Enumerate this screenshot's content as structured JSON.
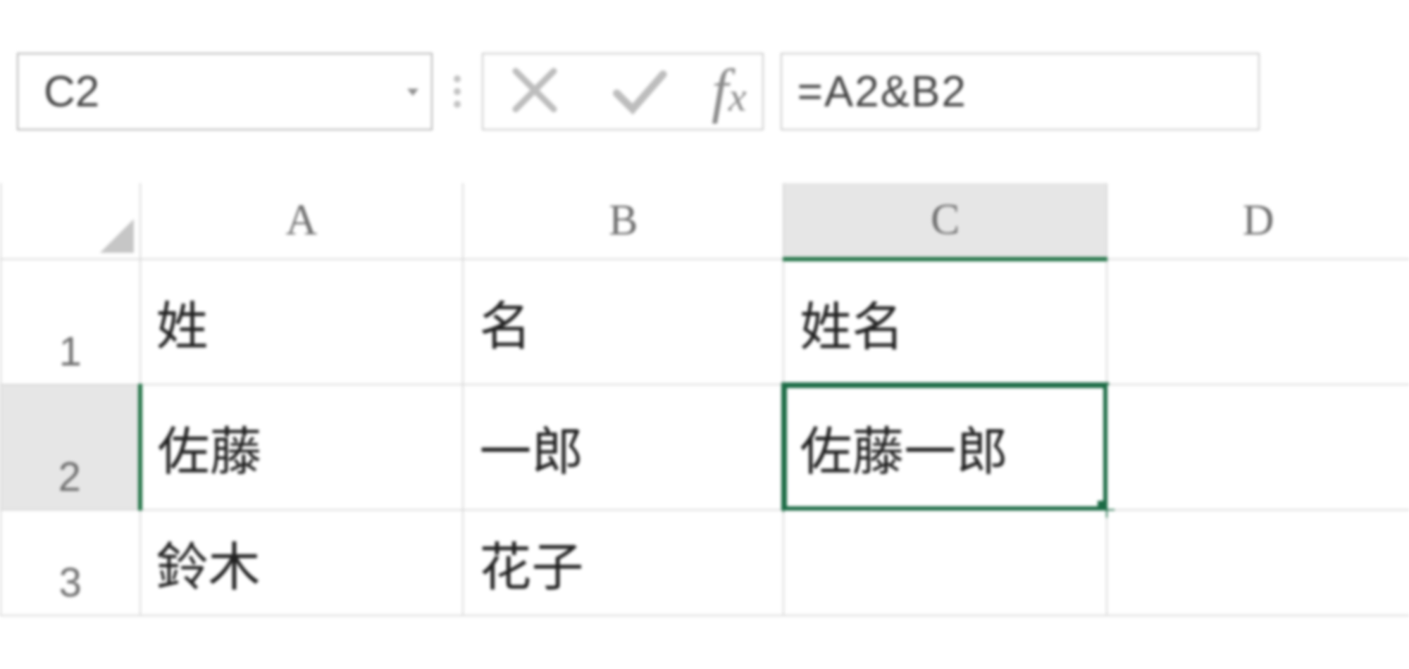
{
  "nameBox": {
    "value": "C2"
  },
  "formula": {
    "value": "=A2&B2"
  },
  "columns": [
    "A",
    "B",
    "C",
    "D"
  ],
  "rows": [
    "1",
    "2",
    "3"
  ],
  "selectedCell": "C2",
  "cells": {
    "A1": "姓",
    "B1": "名",
    "C1": "姓名",
    "D1": "",
    "A2": "佐藤",
    "B2": "一郎",
    "C2": "佐藤一郎",
    "D2": "",
    "A3": "鈴木",
    "B3": "花子",
    "C3": "",
    "D3": ""
  },
  "colors": {
    "selectionBorder": "#1c6b45",
    "gridLine": "#d7d7d7",
    "headerText": "#6e6e6e"
  }
}
